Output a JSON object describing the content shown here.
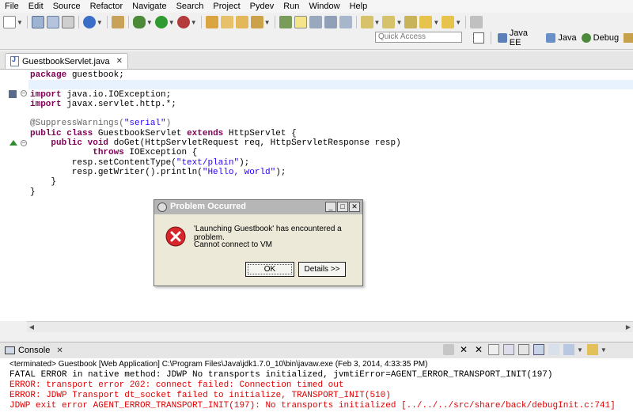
{
  "menubar": {
    "items": [
      "File",
      "Edit",
      "Source",
      "Refactor",
      "Navigate",
      "Search",
      "Project",
      "Pydev",
      "Run",
      "Window",
      "Help"
    ]
  },
  "toolbar": {
    "quick_access_placeholder": "Quick Access",
    "perspectives": [
      {
        "label": "Java EE",
        "icon": "java-ee-perspective-icon"
      },
      {
        "label": "Java",
        "icon": "java-perspective-icon"
      },
      {
        "label": "Debug",
        "icon": "debug-perspective-icon"
      }
    ]
  },
  "editor": {
    "tab_label": "GuestbookServlet.java",
    "lines": [
      "package guestbook;",
      "",
      "import java.io.IOException;",
      "import javax.servlet.http.*;",
      "",
      "@SuppressWarnings(\"serial\")",
      "public class GuestbookServlet extends HttpServlet {",
      "    public void doGet(HttpServletRequest req, HttpServletResponse resp)",
      "            throws IOException {",
      "        resp.setContentType(\"text/plain\");",
      "        resp.getWriter().println(\"Hello, world\");",
      "    }",
      "}"
    ]
  },
  "dialog": {
    "title": "Problem Occurred",
    "message": "'Launching Guestbook' has encountered a problem.",
    "detail": "Cannot connect to VM",
    "ok_label": "OK",
    "details_label": "Details >>",
    "min_label": "_",
    "max_label": "□",
    "close_label": "✕"
  },
  "console": {
    "tab_label": "Console",
    "description": "<terminated> Guestbook [Web Application] C:\\Program Files\\Java\\jdk1.7.0_10\\bin\\javaw.exe (Feb 3, 2014, 4:33:35 PM)",
    "lines": [
      {
        "text": "FATAL ERROR in native method: JDWP No transports initialized, jvmtiError=AGENT_ERROR_TRANSPORT_INIT(197)",
        "color": "#000000"
      },
      {
        "text": "ERROR: transport error 202: connect failed: Connection timed out",
        "color": "#e00000"
      },
      {
        "text": "ERROR: JDWP Transport dt_socket failed to initialize, TRANSPORT_INIT(510)",
        "color": "#e00000"
      },
      {
        "text": "JDWP exit error AGENT_ERROR_TRANSPORT_INIT(197): No transports initialized [../../../src/share/back/debugInit.c:741]",
        "color": "#e00000"
      }
    ]
  },
  "colors": {
    "keyword": "#7f0055",
    "string": "#2a00ff",
    "annotation": "#646464",
    "error": "#e00000"
  }
}
